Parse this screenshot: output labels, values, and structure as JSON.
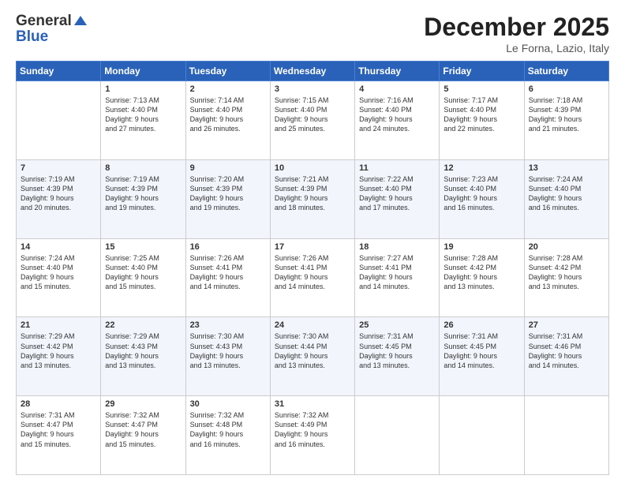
{
  "header": {
    "logo_line1": "General",
    "logo_line2": "Blue",
    "month_title": "December 2025",
    "location": "Le Forna, Lazio, Italy"
  },
  "days_of_week": [
    "Sunday",
    "Monday",
    "Tuesday",
    "Wednesday",
    "Thursday",
    "Friday",
    "Saturday"
  ],
  "weeks": [
    [
      {
        "day": "",
        "info": ""
      },
      {
        "day": "1",
        "info": "Sunrise: 7:13 AM\nSunset: 4:40 PM\nDaylight: 9 hours\nand 27 minutes."
      },
      {
        "day": "2",
        "info": "Sunrise: 7:14 AM\nSunset: 4:40 PM\nDaylight: 9 hours\nand 26 minutes."
      },
      {
        "day": "3",
        "info": "Sunrise: 7:15 AM\nSunset: 4:40 PM\nDaylight: 9 hours\nand 25 minutes."
      },
      {
        "day": "4",
        "info": "Sunrise: 7:16 AM\nSunset: 4:40 PM\nDaylight: 9 hours\nand 24 minutes."
      },
      {
        "day": "5",
        "info": "Sunrise: 7:17 AM\nSunset: 4:40 PM\nDaylight: 9 hours\nand 22 minutes."
      },
      {
        "day": "6",
        "info": "Sunrise: 7:18 AM\nSunset: 4:39 PM\nDaylight: 9 hours\nand 21 minutes."
      }
    ],
    [
      {
        "day": "7",
        "info": "Sunrise: 7:19 AM\nSunset: 4:39 PM\nDaylight: 9 hours\nand 20 minutes."
      },
      {
        "day": "8",
        "info": "Sunrise: 7:19 AM\nSunset: 4:39 PM\nDaylight: 9 hours\nand 19 minutes."
      },
      {
        "day": "9",
        "info": "Sunrise: 7:20 AM\nSunset: 4:39 PM\nDaylight: 9 hours\nand 19 minutes."
      },
      {
        "day": "10",
        "info": "Sunrise: 7:21 AM\nSunset: 4:39 PM\nDaylight: 9 hours\nand 18 minutes."
      },
      {
        "day": "11",
        "info": "Sunrise: 7:22 AM\nSunset: 4:40 PM\nDaylight: 9 hours\nand 17 minutes."
      },
      {
        "day": "12",
        "info": "Sunrise: 7:23 AM\nSunset: 4:40 PM\nDaylight: 9 hours\nand 16 minutes."
      },
      {
        "day": "13",
        "info": "Sunrise: 7:24 AM\nSunset: 4:40 PM\nDaylight: 9 hours\nand 16 minutes."
      }
    ],
    [
      {
        "day": "14",
        "info": "Sunrise: 7:24 AM\nSunset: 4:40 PM\nDaylight: 9 hours\nand 15 minutes."
      },
      {
        "day": "15",
        "info": "Sunrise: 7:25 AM\nSunset: 4:40 PM\nDaylight: 9 hours\nand 15 minutes."
      },
      {
        "day": "16",
        "info": "Sunrise: 7:26 AM\nSunset: 4:41 PM\nDaylight: 9 hours\nand 14 minutes."
      },
      {
        "day": "17",
        "info": "Sunrise: 7:26 AM\nSunset: 4:41 PM\nDaylight: 9 hours\nand 14 minutes."
      },
      {
        "day": "18",
        "info": "Sunrise: 7:27 AM\nSunset: 4:41 PM\nDaylight: 9 hours\nand 14 minutes."
      },
      {
        "day": "19",
        "info": "Sunrise: 7:28 AM\nSunset: 4:42 PM\nDaylight: 9 hours\nand 13 minutes."
      },
      {
        "day": "20",
        "info": "Sunrise: 7:28 AM\nSunset: 4:42 PM\nDaylight: 9 hours\nand 13 minutes."
      }
    ],
    [
      {
        "day": "21",
        "info": "Sunrise: 7:29 AM\nSunset: 4:42 PM\nDaylight: 9 hours\nand 13 minutes."
      },
      {
        "day": "22",
        "info": "Sunrise: 7:29 AM\nSunset: 4:43 PM\nDaylight: 9 hours\nand 13 minutes."
      },
      {
        "day": "23",
        "info": "Sunrise: 7:30 AM\nSunset: 4:43 PM\nDaylight: 9 hours\nand 13 minutes."
      },
      {
        "day": "24",
        "info": "Sunrise: 7:30 AM\nSunset: 4:44 PM\nDaylight: 9 hours\nand 13 minutes."
      },
      {
        "day": "25",
        "info": "Sunrise: 7:31 AM\nSunset: 4:45 PM\nDaylight: 9 hours\nand 13 minutes."
      },
      {
        "day": "26",
        "info": "Sunrise: 7:31 AM\nSunset: 4:45 PM\nDaylight: 9 hours\nand 14 minutes."
      },
      {
        "day": "27",
        "info": "Sunrise: 7:31 AM\nSunset: 4:46 PM\nDaylight: 9 hours\nand 14 minutes."
      }
    ],
    [
      {
        "day": "28",
        "info": "Sunrise: 7:31 AM\nSunset: 4:47 PM\nDaylight: 9 hours\nand 15 minutes."
      },
      {
        "day": "29",
        "info": "Sunrise: 7:32 AM\nSunset: 4:47 PM\nDaylight: 9 hours\nand 15 minutes."
      },
      {
        "day": "30",
        "info": "Sunrise: 7:32 AM\nSunset: 4:48 PM\nDaylight: 9 hours\nand 16 minutes."
      },
      {
        "day": "31",
        "info": "Sunrise: 7:32 AM\nSunset: 4:49 PM\nDaylight: 9 hours\nand 16 minutes."
      },
      {
        "day": "",
        "info": ""
      },
      {
        "day": "",
        "info": ""
      },
      {
        "day": "",
        "info": ""
      }
    ]
  ]
}
